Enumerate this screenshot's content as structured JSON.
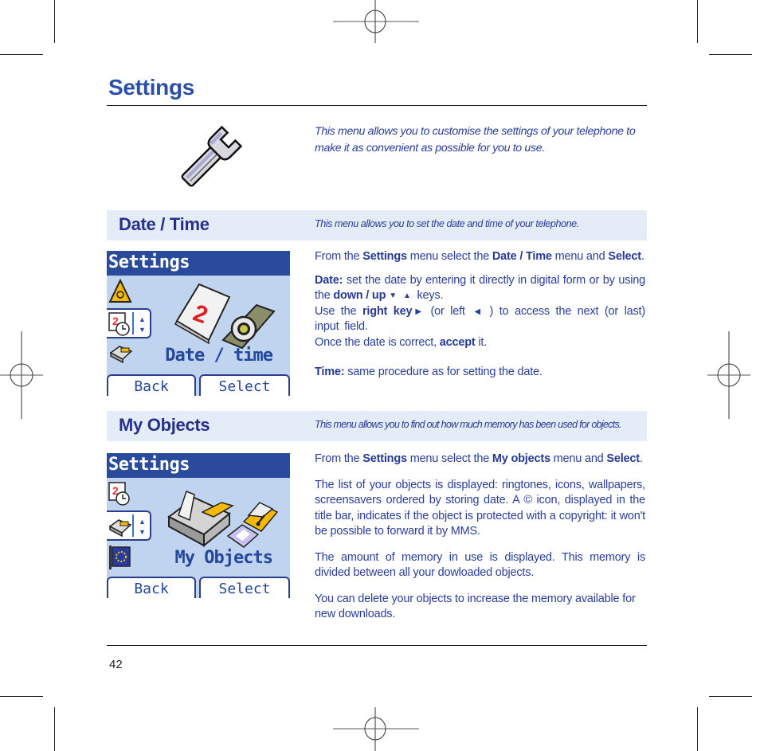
{
  "page": {
    "title": "Settings",
    "intro": "This menu allows you to customise the settings of your telephone to make it as convenient as possible for you to use.",
    "page_number": "42",
    "icon": "wrench-icon"
  },
  "colors": {
    "title_blue": "#2a4fa8",
    "text_blue": "#2b3f9a",
    "section_bg": "#e4ecf7",
    "phone_header": "#2a4a9c",
    "phone_bg": "#c0d4ef"
  },
  "sections": [
    {
      "title": "Date / Time",
      "description": "This menu allows you to set the date and time of your telephone.",
      "phone": {
        "header": "Settings",
        "caption": "Date / time",
        "softkey_left": "Back",
        "softkey_right": "Select",
        "icons": [
          "alarm-icon",
          "date-time-icon",
          "objects-icon",
          "calendar-icon",
          "watch-icon"
        ]
      },
      "body": {
        "p1_a": "From the ",
        "p1_b": "Settings",
        "p1_c": " menu select the ",
        "p1_d": "Date / Time",
        "p1_e": " menu and ",
        "p1_f": "Select",
        "p1_g": ".",
        "date_label": "Date:",
        "date_text": " set the date by entering it directly in digital form or by using the ",
        "date_keys": "down / up",
        "down_glyph": "▼",
        "up_glyph": "▲",
        "date_keys_end": " keys.",
        "use_a": "Use the ",
        "use_b": "right key",
        "right_glyph": "▶",
        "use_c": " (or left ",
        "left_glyph": "◀",
        "use_d": " ) to access the next (or last) input field.",
        "once_a": "Once the date is correct, ",
        "once_b": "accept",
        "once_c": " it.",
        "time_label": "Time:",
        "time_text": " same procedure as for setting the date."
      }
    },
    {
      "title": "My Objects",
      "description": "This menu allows you to find out how much memory has been used for objects.",
      "phone": {
        "header": "Settings",
        "caption": "My Objects",
        "softkey_left": "Back",
        "softkey_right": "Select",
        "icons": [
          "date-time-icon",
          "objects-icon",
          "language-flag-icon",
          "objects-box-icon",
          "ringtone-icon"
        ]
      },
      "body": {
        "p1_a": "From the ",
        "p1_b": "Settings",
        "p1_c": " menu select the ",
        "p1_d": "My objects",
        "p1_e": " menu and ",
        "p1_f": "Select",
        "p1_g": ".",
        "p2": "The list of your objects is displayed: ringtones, icons, wallpapers, screensavers ordered by storing date. A © icon, displayed in the title bar, indicates if the object is protected with a copyright: it won't be possible to forward it by MMS.",
        "p3": "The amount of memory in use is displayed. This memory is divided between all your dowloaded objects.",
        "p4": "You can delete your objects to increase the memory available for new downloads."
      }
    }
  ]
}
